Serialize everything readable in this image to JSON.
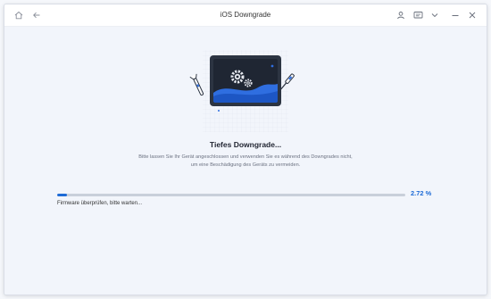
{
  "window": {
    "title": "iOS Downgrade"
  },
  "titlebar": {
    "left_icons": [
      "home-icon",
      "back-arrow-icon"
    ],
    "right_icons": [
      "user-icon",
      "chat-icon",
      "chevron-down-icon",
      "minimize-icon",
      "close-icon"
    ]
  },
  "main": {
    "heading": "Tiefes Downgrade...",
    "description_line1": "Bitte lassen Sie Ihr Gerät angeschlossen und verwenden Sie es während des Downgrades nicht,",
    "description_line2": "um eine Beschädigung des Geräts zu vermeiden.",
    "progress": {
      "fraction": 0.0272,
      "percent_label": "2.72 %",
      "status_text": "Firmware überprüfen, bitte warten..."
    }
  },
  "colors": {
    "accent": "#1e6bd6",
    "background": "#f2f5fb",
    "illustration_dark": "#2c3442"
  }
}
